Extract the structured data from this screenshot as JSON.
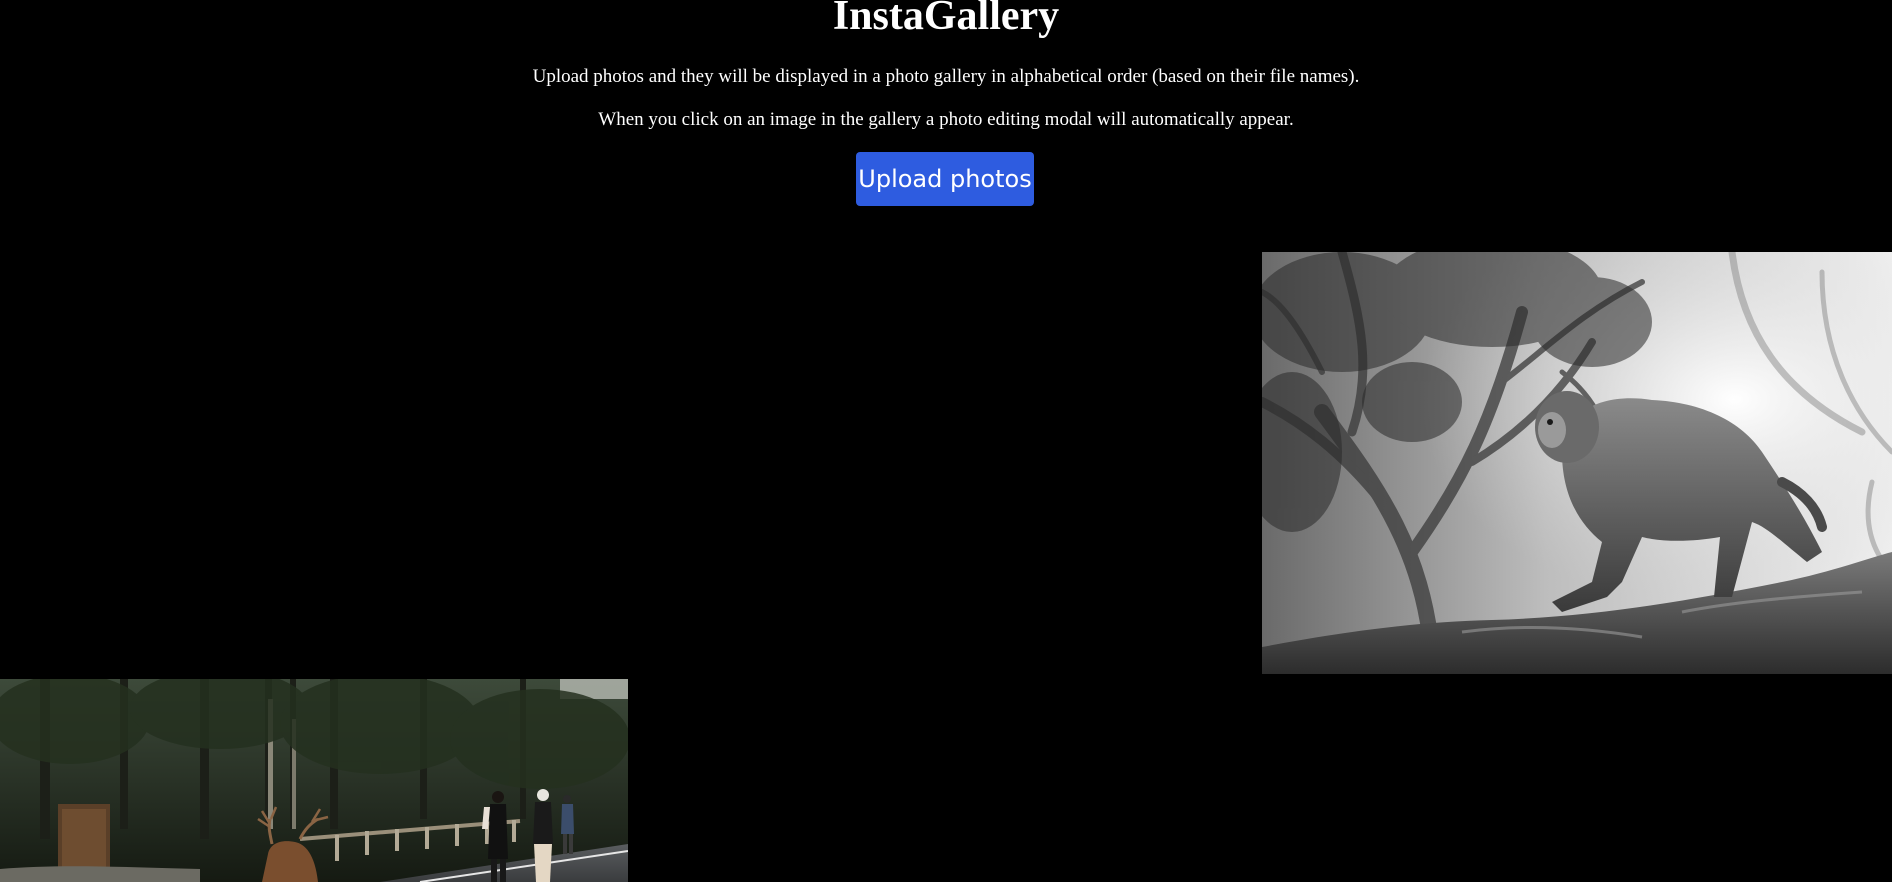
{
  "header": {
    "title": "InstaGallery",
    "description_1": "Upload photos and they will be displayed in a photo gallery in alphabetical order (based on their file names).",
    "description_2": "When you click on an image in the gallery a photo editing modal will automatically appear.",
    "upload_label": "Upload photos"
  },
  "colors": {
    "background": "#000000",
    "text": "#ffffff",
    "accent": "#2e5ce0"
  },
  "gallery": {
    "images": [
      {
        "subject": "black-and-white monkey walking on rock"
      },
      {
        "subject": "deer on road with people walking in forest"
      }
    ]
  }
}
